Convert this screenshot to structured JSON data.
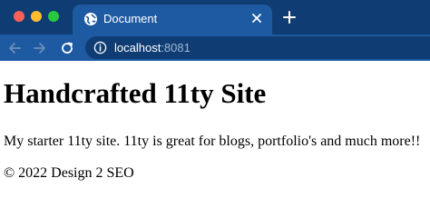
{
  "browser": {
    "tab": {
      "title": "Document",
      "favicon": "globe-icon"
    },
    "new_tab_icon": "plus-icon",
    "nav": {
      "back_icon": "arrow-left-icon",
      "forward_icon": "arrow-right-icon",
      "reload_icon": "reload-icon"
    },
    "address": {
      "host": "localhost",
      "port": ":8081",
      "security_icon": "info-icon"
    },
    "colors": {
      "titlebar": "#0f3d73",
      "toolbar": "#1d5aa2",
      "omnibox": "#0f3d73"
    }
  },
  "page": {
    "heading": "Handcrafted 11ty Site",
    "paragraph": "My starter 11ty site. 11ty is great for blogs, portfolio's and much more!!",
    "footer": "© 2022 Design 2 SEO"
  }
}
